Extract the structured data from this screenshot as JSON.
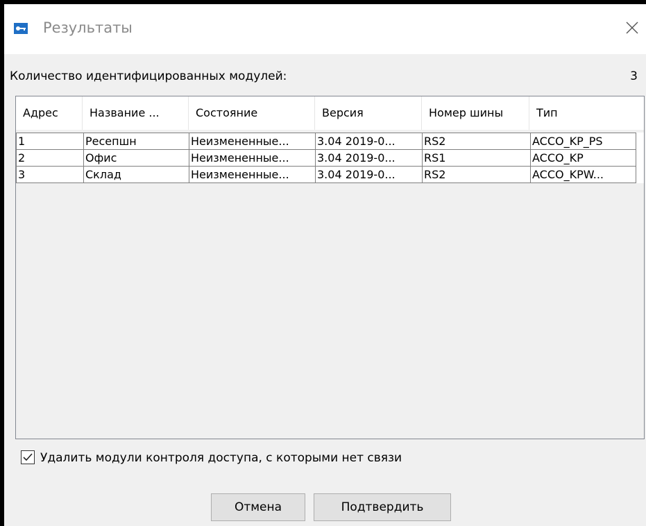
{
  "window": {
    "title": "Результаты",
    "close_label": "×"
  },
  "summary": {
    "label": "Количество идентифицированных модулей:",
    "value": "3"
  },
  "table": {
    "columns": [
      "Адрес",
      "Название ...",
      "Состояние",
      "Версия",
      "Номер шины",
      "Тип"
    ],
    "rows": [
      [
        "1",
        "Ресепшн",
        "Неизмененные...",
        "3.04 2019-0...",
        "RS2",
        "ACCO_KP_PS"
      ],
      [
        "2",
        "Офис",
        "Неизмененные...",
        "3.04 2019-0...",
        "RS1",
        "ACCO_KP"
      ],
      [
        "3",
        "Склад",
        "Неизмененные...",
        "3.04 2019-0...",
        "RS2",
        "ACCO_KPW..."
      ]
    ]
  },
  "options": {
    "remove_unreachable_label": "Удалить модули контроля доступа, с которыми нет связи",
    "remove_unreachable_checked": true
  },
  "buttons": {
    "cancel": "Отмена",
    "confirm": "Подтвердить"
  },
  "colors": {
    "icon_accent": "#1f6fc5",
    "title_text": "#8a8a8a",
    "window_bg": "#f0f0f0"
  }
}
